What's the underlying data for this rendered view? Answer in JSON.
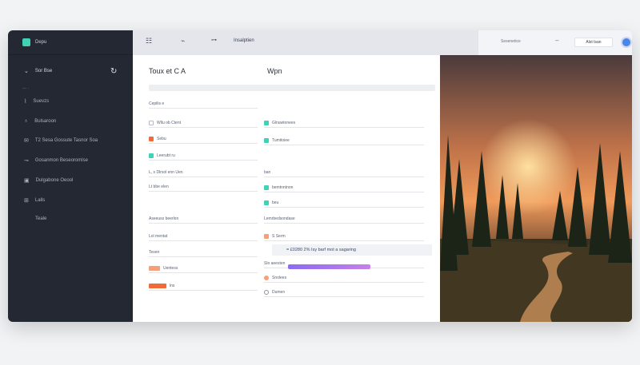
{
  "sidebar": {
    "app_name": "Depu",
    "current": "Sor Bse",
    "items": [
      {
        "label": "Suevzs",
        "icon": "mic-icon"
      },
      {
        "label": "Bulsaroon",
        "icon": "bell-icon"
      },
      {
        "label": "T2  Sesa    Gossute    Tasnor Soa",
        "icon": "chat-icon"
      },
      {
        "label": "Gosanmon Beseoromlse",
        "icon": "tag-icon"
      },
      {
        "label": "Dulgabone Oeool",
        "icon": "folder-icon"
      },
      {
        "label": "Lalls",
        "icon": "grid-icon"
      },
      {
        "label": "Teale",
        "icon": "none"
      }
    ]
  },
  "topbar": {
    "title": "Insalptien",
    "search_label": "Sesenetice",
    "button_label": "Alst tsan"
  },
  "left_column": {
    "title": "Toux et C A",
    "fields": [
      "Cepilis e",
      "Wllu ob Ctent",
      "Sebu",
      "Leerubt ru",
      "L, s  Dlrsol enn Uen",
      "Lt bbe  elen",
      "Aseeuss beerlon",
      "Lol mentat",
      "Tesen",
      "Uentess",
      "lns"
    ]
  },
  "right_column": {
    "title": "Wpn",
    "fields": [
      "Glnuwtonees",
      "Tumitoiee",
      "ban",
      "bemtnntnon",
      "beu",
      "Lemrbedsondase",
      "S Serm",
      "Slo aeesten",
      "Snolees",
      "Dumen"
    ],
    "highlight_text": "= £0280 2% Isy barf mot a sagaring",
    "progress": 0.45
  },
  "colors": {
    "sidebar_bg": "#232833",
    "accent": "#3fd2b4",
    "warning": "#f06a3a",
    "avatar": "#4a86e8",
    "progress": "#a276ec"
  }
}
